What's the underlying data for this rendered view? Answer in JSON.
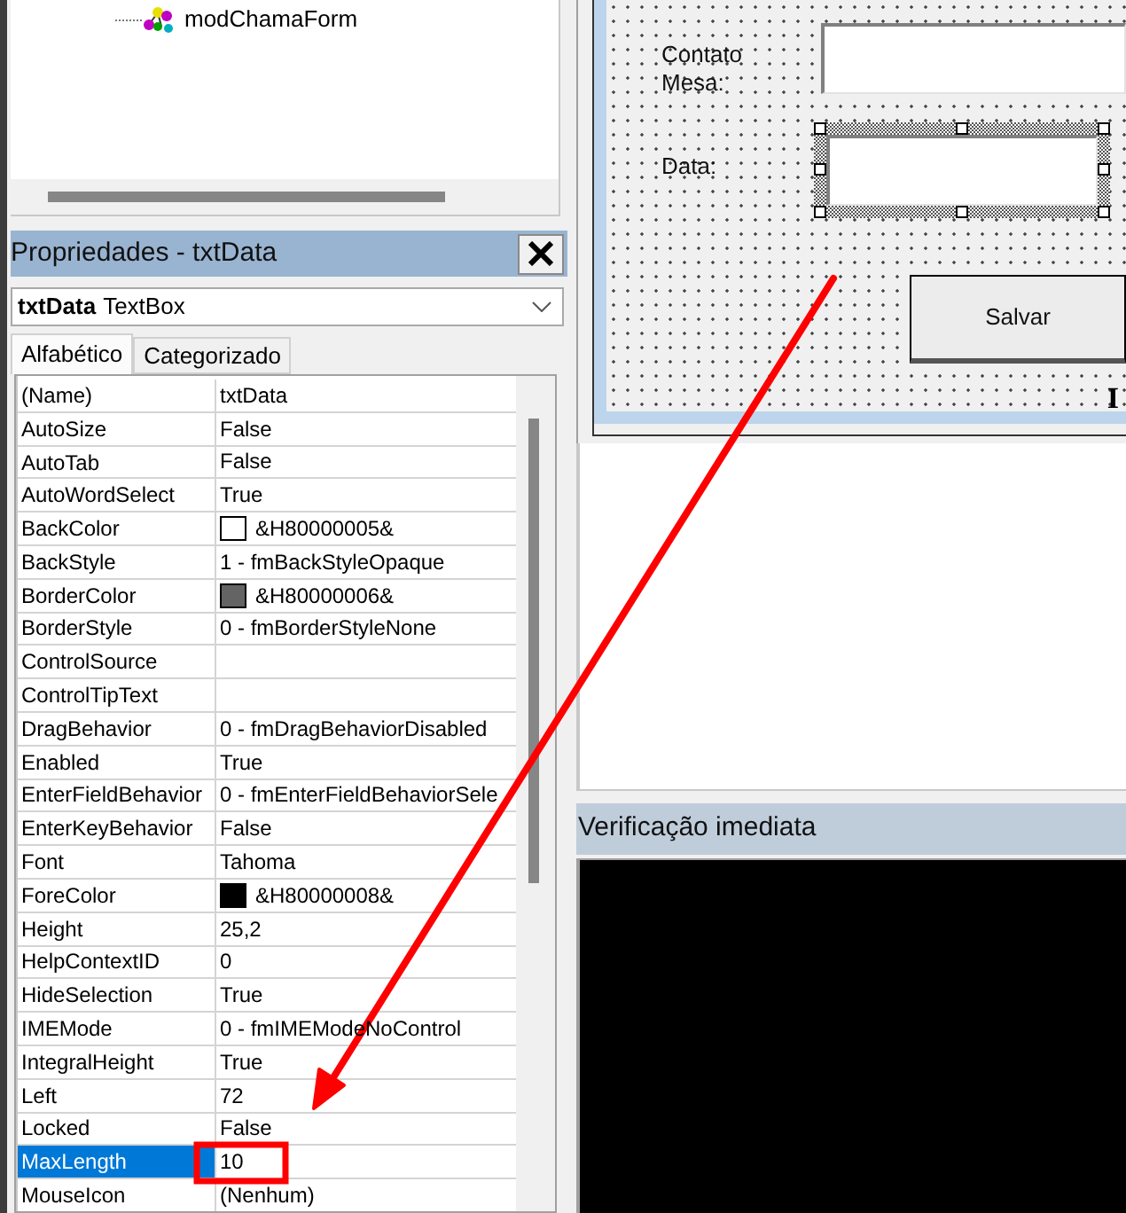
{
  "project_tree": {
    "items": [
      {
        "label": "modChamaForm"
      }
    ]
  },
  "properties_window": {
    "title": "Propriedades - txtData",
    "object": {
      "name": "txtData",
      "type": "TextBox"
    },
    "tabs": [
      {
        "label": "Alfabético",
        "selected": true
      },
      {
        "label": "Categorizado",
        "selected": false
      }
    ],
    "properties": [
      {
        "name": "(Name)",
        "value": "txtData",
        "selected": false
      },
      {
        "name": "AutoSize",
        "value": "False",
        "selected": false
      },
      {
        "name": "AutoTab",
        "value": "False",
        "selected": false
      },
      {
        "name": "AutoWordSelect",
        "value": "True",
        "selected": false
      },
      {
        "name": "BackColor",
        "value": "&H80000005&",
        "color": "#ffffff",
        "selected": false
      },
      {
        "name": "BackStyle",
        "value": "1 - fmBackStyleOpaque",
        "selected": false
      },
      {
        "name": "BorderColor",
        "value": "&H80000006&",
        "color": "#646464",
        "selected": false
      },
      {
        "name": "BorderStyle",
        "value": "0 - fmBorderStyleNone",
        "selected": false
      },
      {
        "name": "ControlSource",
        "selected": false
      },
      {
        "name": "ControlTipText",
        "selected": false
      },
      {
        "name": "DragBehavior",
        "value": "0 - fmDragBehaviorDisabled",
        "selected": false
      },
      {
        "name": "Enabled",
        "value": "True",
        "selected": false
      },
      {
        "name": "EnterFieldBehavior",
        "value": "0 - fmEnterFieldBehaviorSele",
        "selected": false
      },
      {
        "name": "EnterKeyBehavior",
        "value": "False",
        "selected": false
      },
      {
        "name": "Font",
        "value": "Tahoma",
        "selected": false
      },
      {
        "name": "ForeColor",
        "value": "&H80000008&",
        "color": "#000000",
        "selected": false
      },
      {
        "name": "Height",
        "value": "25,2",
        "selected": false
      },
      {
        "name": "HelpContextID",
        "value": "0",
        "selected": false
      },
      {
        "name": "HideSelection",
        "value": "True",
        "selected": false
      },
      {
        "name": "IMEMode",
        "value": "0 - fmIMEModeNoControl",
        "selected": false
      },
      {
        "name": "IntegralHeight",
        "value": "True",
        "selected": false
      },
      {
        "name": "Left",
        "value": "72",
        "selected": false
      },
      {
        "name": "Locked",
        "value": "False",
        "selected": false
      },
      {
        "name": "MaxLength",
        "value": "10",
        "selected": true
      },
      {
        "name": "MouseIcon",
        "value": "(Nenhum)",
        "selected": false
      }
    ]
  },
  "form_designer": {
    "fields": [
      {
        "label": "Contato Mesa:",
        "selected": false
      },
      {
        "label": "Data:",
        "selected": true
      }
    ],
    "button": "Salvar",
    "partial_caption": "I"
  },
  "immediate_window": {
    "title": "Verificação imediata"
  }
}
